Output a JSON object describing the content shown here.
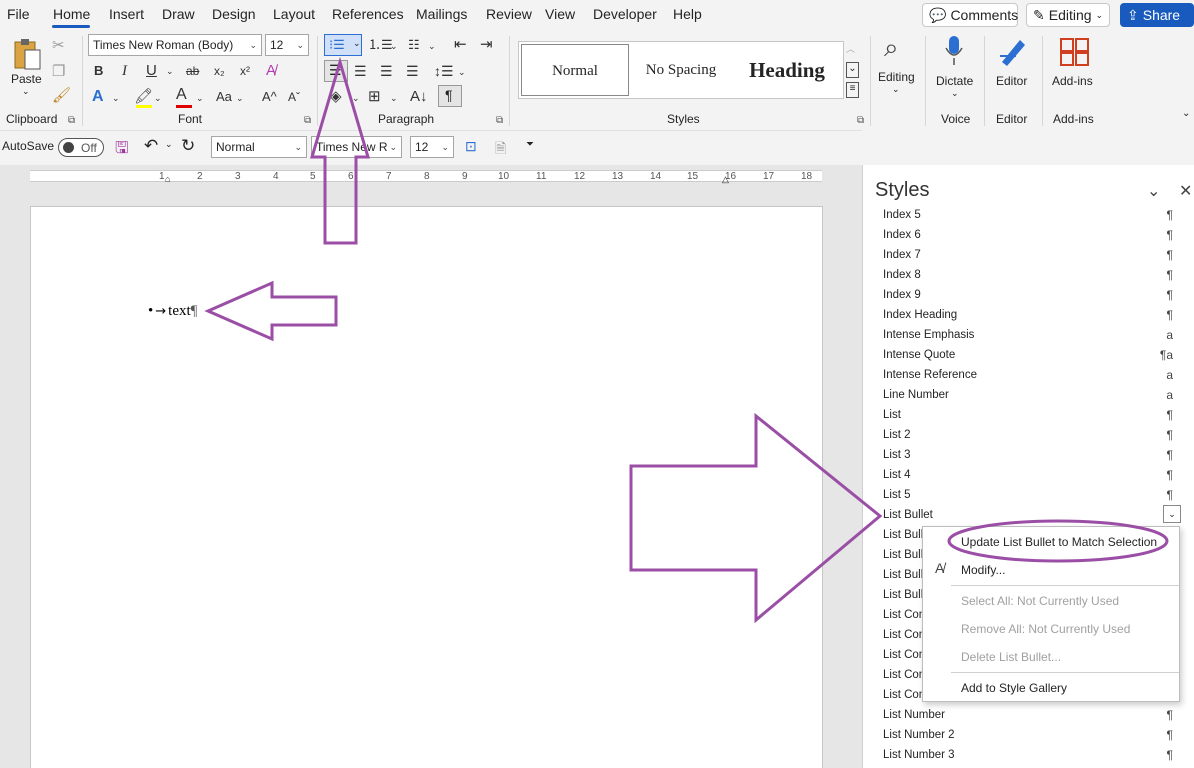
{
  "menu": {
    "tabs": [
      "File",
      "Home",
      "Insert",
      "Draw",
      "Design",
      "Layout",
      "References",
      "Mailings",
      "Review",
      "View",
      "Developer",
      "Help"
    ],
    "comments": "Comments",
    "editing": "Editing",
    "share": "Share"
  },
  "ribbon": {
    "clipboard": {
      "paste": "Paste",
      "label": "Clipboard"
    },
    "font": {
      "name": "Times New Roman (Body)",
      "size": "12",
      "label": "Font",
      "bold": "B",
      "italic": "I",
      "underline": "U",
      "strike": "ab",
      "sub": "x₂",
      "sup": "x²",
      "aa": "Aa"
    },
    "paragraph": {
      "label": "Paragraph"
    },
    "styles": {
      "label": "Styles",
      "normal": "Normal",
      "nospacing": "No Spacing",
      "heading": "Heading"
    },
    "editing": {
      "label": "Editing"
    },
    "voice": {
      "dictate": "Dictate",
      "label": "Voice"
    },
    "editor": {
      "btn": "Editor",
      "label": "Editor"
    },
    "addins": {
      "btn": "Add-ins",
      "label": "Add-ins"
    }
  },
  "qat": {
    "autosave": "AutoSave",
    "toggle": "Off",
    "style": "Normal",
    "font": "Times New R",
    "size": "12"
  },
  "ruler": [
    "1",
    "2",
    "3",
    "4",
    "5",
    "6",
    "7",
    "8",
    "9",
    "10",
    "11",
    "12",
    "13",
    "14",
    "15",
    "16",
    "17",
    "18"
  ],
  "document": {
    "bullet": "•",
    "arrow": "→",
    "text": "text",
    "pilcrow": "¶"
  },
  "styles_pane": {
    "title": "Styles",
    "items": [
      {
        "name": "Index 5",
        "mark": "¶"
      },
      {
        "name": "Index 6",
        "mark": "¶"
      },
      {
        "name": "Index 7",
        "mark": "¶"
      },
      {
        "name": "Index 8",
        "mark": "¶"
      },
      {
        "name": "Index 9",
        "mark": "¶"
      },
      {
        "name": "Index Heading",
        "mark": "¶"
      },
      {
        "name": "Intense Emphasis",
        "mark": "a"
      },
      {
        "name": "Intense Quote",
        "mark": "¶a"
      },
      {
        "name": "Intense Reference",
        "mark": "a"
      },
      {
        "name": "Line Number",
        "mark": "a"
      },
      {
        "name": "List",
        "mark": "¶"
      },
      {
        "name": "List 2",
        "mark": "¶"
      },
      {
        "name": "List 3",
        "mark": "¶"
      },
      {
        "name": "List 4",
        "mark": "¶"
      },
      {
        "name": "List 5",
        "mark": "¶"
      },
      {
        "name": "List Bullet",
        "mark": "¶"
      },
      {
        "name": "List Bulle",
        "mark": ""
      },
      {
        "name": "List Bulle",
        "mark": ""
      },
      {
        "name": "List Bulle",
        "mark": ""
      },
      {
        "name": "List Bulle",
        "mark": ""
      },
      {
        "name": "List Con",
        "mark": ""
      },
      {
        "name": "List Con",
        "mark": ""
      },
      {
        "name": "List Con",
        "mark": ""
      },
      {
        "name": "List Con",
        "mark": ""
      },
      {
        "name": "List Con",
        "mark": ""
      },
      {
        "name": "List Number",
        "mark": "¶"
      },
      {
        "name": "List Number 2",
        "mark": "¶"
      },
      {
        "name": "List Number 3",
        "mark": "¶"
      }
    ]
  },
  "context_menu": {
    "update": "Update List Bullet to Match Selection",
    "modify": "Modify...",
    "select_all": "Select All: Not Currently Used",
    "remove_all": "Remove All: Not Currently Used",
    "delete": "Delete List Bullet...",
    "add_gallery": "Add to Style Gallery"
  },
  "colors": {
    "accent": "#185abd",
    "annotation": "#9b4ea5"
  }
}
